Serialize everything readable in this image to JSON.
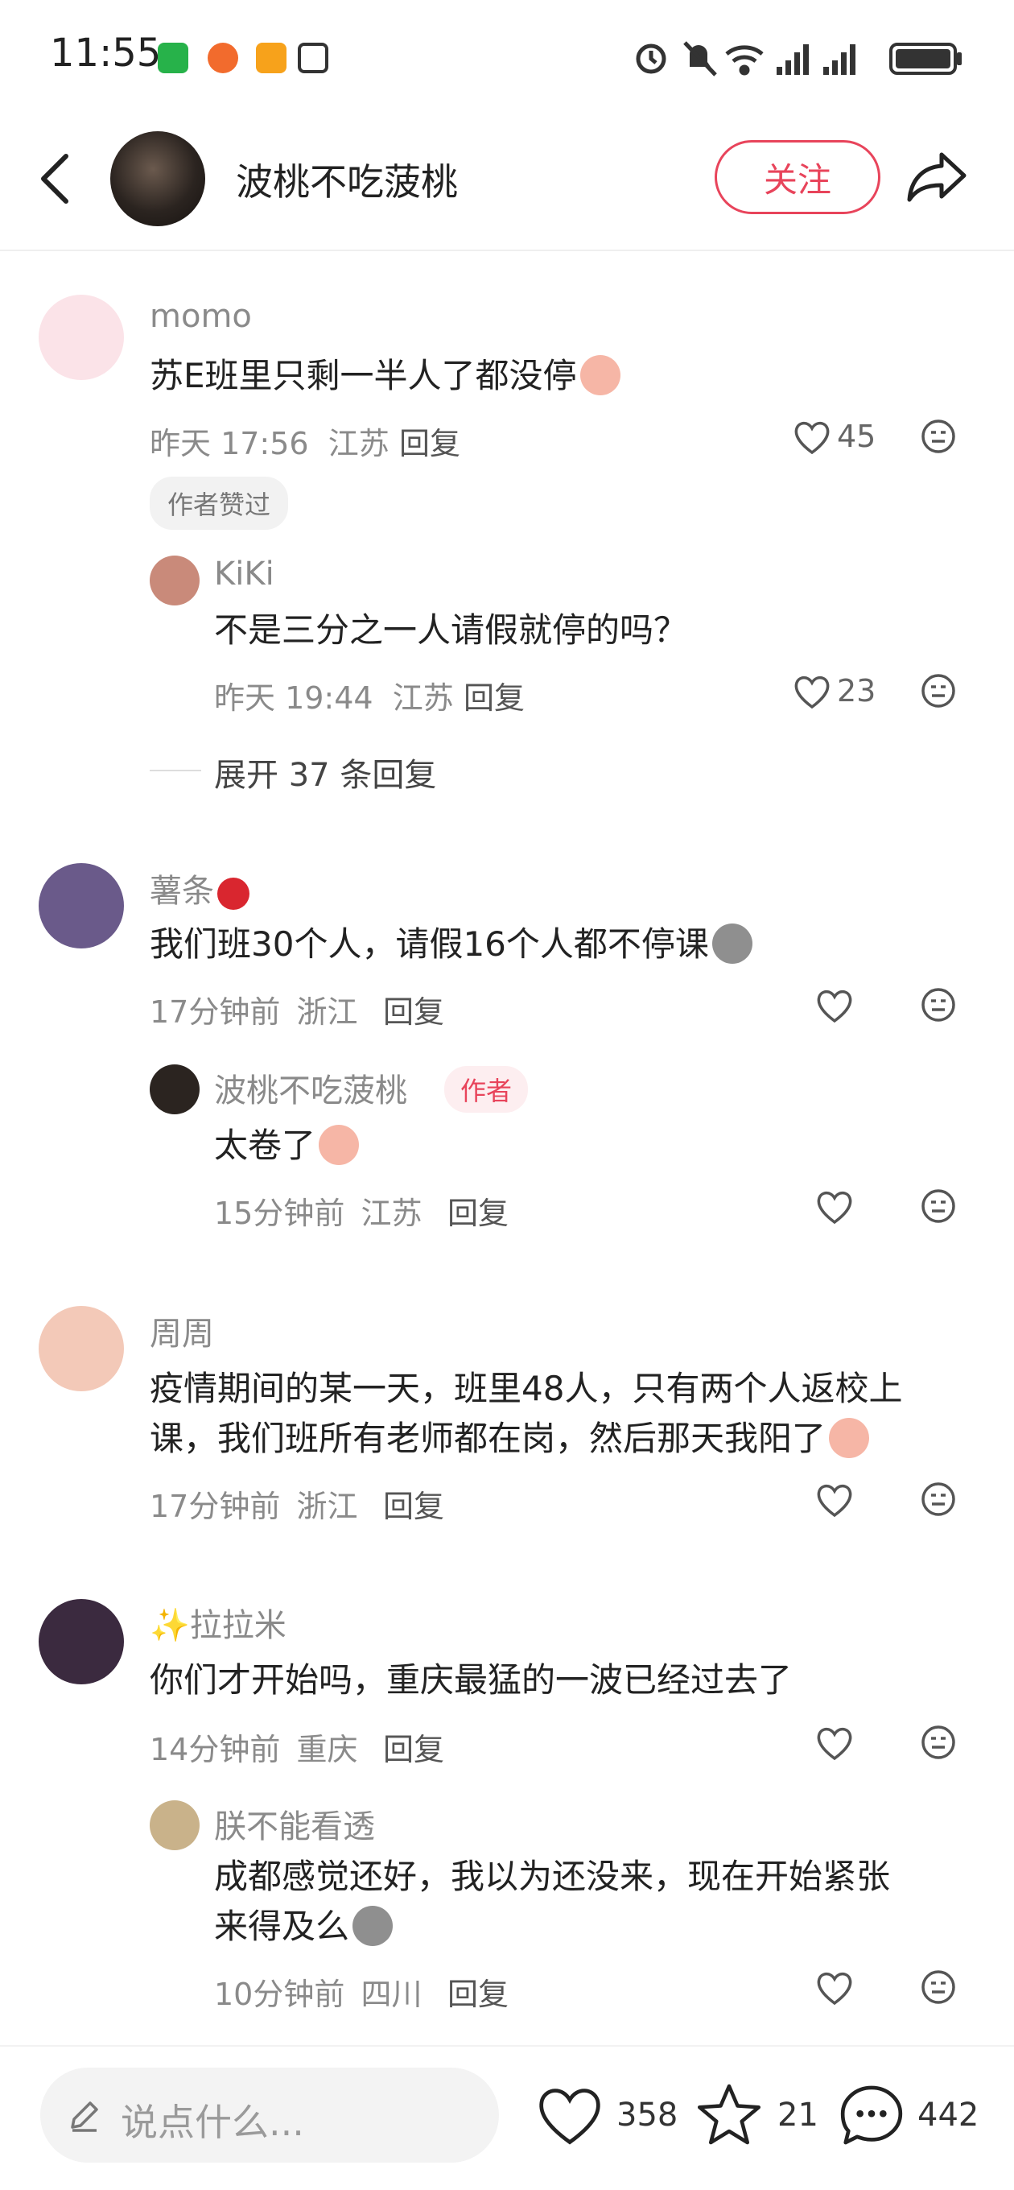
{
  "status_bar": {
    "time": "11:55",
    "apps": [
      "app-icon-green",
      "app-icon-orange",
      "app-icon-orange2",
      "nfc-icon"
    ],
    "right_icons": [
      "alarm-icon",
      "mute-icon",
      "wifi-icon",
      "signal-icon",
      "signal-icon",
      "battery-icon"
    ]
  },
  "header": {
    "title": "波桃不吃菠桃",
    "follow_label": "关注"
  },
  "comments": [
    {
      "name": "momo",
      "text": "苏E班里只剩一半人了都没停",
      "time": "昨天 17:56",
      "location": "江苏",
      "reply_label": "回复",
      "likes": "45",
      "tag": "作者赞过",
      "replies": [
        {
          "name": "KiKi",
          "text": "不是三分之一人请假就停的吗？",
          "time": "昨天 19:44",
          "location": "江苏",
          "reply_label": "回复",
          "likes": "23"
        }
      ],
      "expand_label": "展开 37 条回复"
    },
    {
      "name": "薯条",
      "text": "我们班30个人，请假16个人都不停课",
      "time": "17分钟前",
      "location": "浙江",
      "reply_label": "回复",
      "replies": [
        {
          "name": "波桃不吃菠桃",
          "author_tag": "作者",
          "text": "太卷了",
          "time": "15分钟前",
          "location": "江苏",
          "reply_label": "回复"
        }
      ]
    },
    {
      "name": "周周",
      "text_line1": "疫情期间的某一天，班里48人，只有两个人返校上",
      "text_line2": "课，我们班所有老师都在岗，然后那天我阳了",
      "time": "17分钟前",
      "location": "浙江",
      "reply_label": "回复"
    },
    {
      "name": "✨拉拉米",
      "text": "你们才开始吗，重庆最猛的一波已经过去了",
      "time": "14分钟前",
      "location": "重庆",
      "reply_label": "回复",
      "replies": [
        {
          "name": "朕不能看透",
          "text_line1": "成都感觉还好，我以为还没来，现在开始紧张",
          "text_line2": "来得及么",
          "time": "10分钟前",
          "location": "四川",
          "reply_label": "回复"
        }
      ]
    }
  ],
  "bottom_bar": {
    "placeholder": "说点什么...",
    "likes": "358",
    "stars": "21",
    "comments": "442"
  },
  "colors": {
    "accent": "#e8445b",
    "meta_gray": "#8a8a8a"
  }
}
